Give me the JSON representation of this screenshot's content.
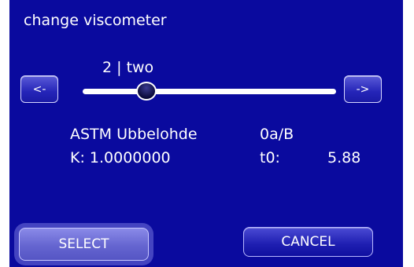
{
  "screen": {
    "title": "change viscometer"
  },
  "selector": {
    "value_label": "2 | two",
    "prev_label": "<-",
    "next_label": "->",
    "slider_position_fraction": 0.25
  },
  "viscometer": {
    "name": "ASTM Ubbelohde",
    "code": "0a/B",
    "k_text": "K: 1.0000000",
    "t0_label": "t0:",
    "t0_value": "5.88"
  },
  "actions": {
    "select_label": "SELECT",
    "cancel_label": "CANCEL"
  },
  "colors": {
    "background": "#0a0a9e",
    "button": "#2525b8",
    "selected_button": "#6565d0",
    "text": "#ffffff"
  }
}
